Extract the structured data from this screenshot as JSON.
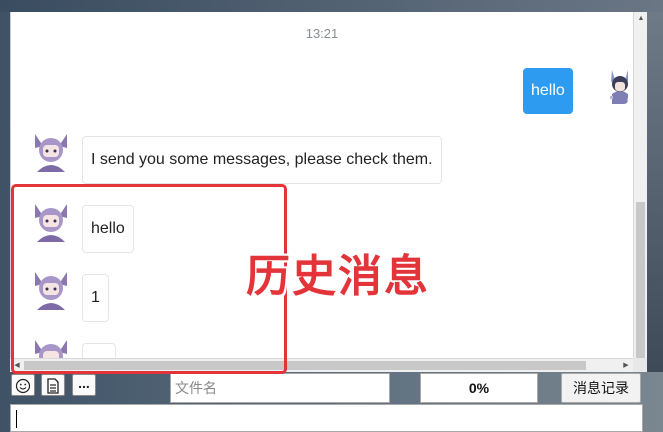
{
  "chat": {
    "timestamp": "13:21",
    "outgoing": [
      {
        "text": "hello"
      }
    ],
    "incoming": [
      {
        "text": "I send you some messages, please check them."
      },
      {
        "text": "hello"
      },
      {
        "text": "1"
      },
      {
        "text": ""
      }
    ]
  },
  "toolbar": {
    "emoji_icon": "emoji-icon",
    "file_icon": "file-icon",
    "more_label": "...",
    "filename_placeholder": "文件名",
    "progress_value": "0%",
    "history_label": "消息记录"
  },
  "input": {
    "value": ""
  },
  "annotation": {
    "label": "历史消息",
    "color": "#e3343a"
  },
  "colors": {
    "outgoing_bubble": "#2d9cf0",
    "annotation": "#e3343a"
  }
}
